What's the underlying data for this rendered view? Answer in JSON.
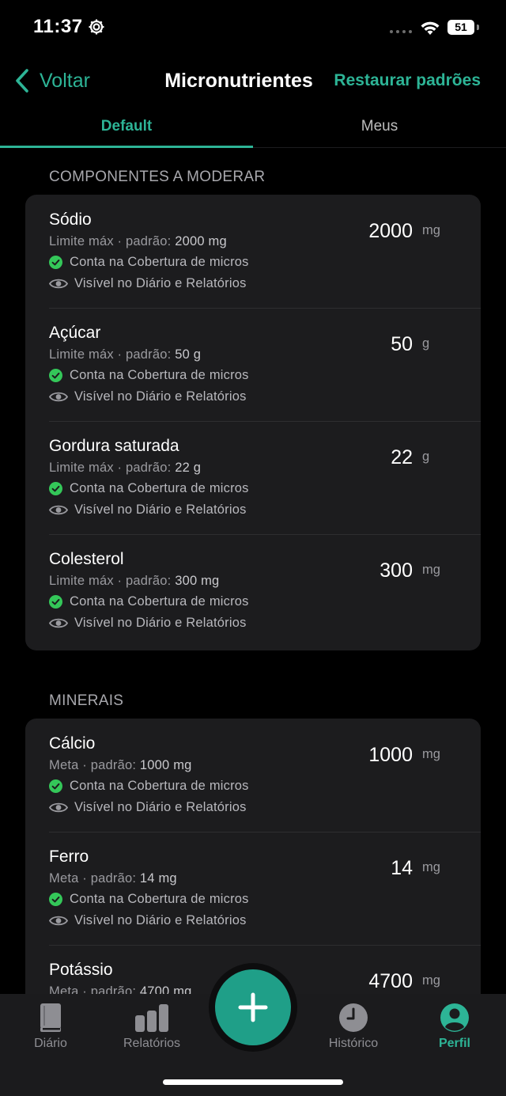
{
  "status": {
    "time": "11:37",
    "battery": "51"
  },
  "nav": {
    "back_label": "Voltar",
    "title": "Micronutrientes",
    "restore_label": "Restaurar padrões"
  },
  "tabs": [
    {
      "label": "Default"
    },
    {
      "label": "Meus"
    }
  ],
  "flags": {
    "micros": "Conta na Cobertura de micros",
    "visible": "Visível no Diário e Relatórios"
  },
  "sections": [
    {
      "title": "COMPONENTES A MODERAR",
      "items": [
        {
          "name": "Sódio",
          "limit_prefix": "Limite máx · padrão:",
          "limit_value": "2000 mg",
          "value": "2000",
          "unit": "mg"
        },
        {
          "name": "Açúcar",
          "limit_prefix": "Limite máx · padrão:",
          "limit_value": "50 g",
          "value": "50",
          "unit": "g"
        },
        {
          "name": "Gordura saturada",
          "limit_prefix": "Limite máx · padrão:",
          "limit_value": "22 g",
          "value": "22",
          "unit": "g"
        },
        {
          "name": "Colesterol",
          "limit_prefix": "Limite máx · padrão:",
          "limit_value": "300 mg",
          "value": "300",
          "unit": "mg"
        }
      ]
    },
    {
      "title": "MINERAIS",
      "items": [
        {
          "name": "Cálcio",
          "limit_prefix": "Meta · padrão:",
          "limit_value": "1000 mg",
          "value": "1000",
          "unit": "mg"
        },
        {
          "name": "Ferro",
          "limit_prefix": "Meta · padrão:",
          "limit_value": "14 mg",
          "value": "14",
          "unit": "mg"
        },
        {
          "name": "Potássio",
          "limit_prefix": "Meta · padrão:",
          "limit_value": "4700 mg",
          "value": "4700",
          "unit": "mg"
        }
      ]
    }
  ],
  "tab_bar": [
    {
      "label": "Diário",
      "icon": "book-icon"
    },
    {
      "label": "Relatórios",
      "icon": "bar-chart-icon"
    },
    {
      "label": "Histórico",
      "icon": "clock-icon"
    },
    {
      "label": "Perfil",
      "icon": "profile-icon"
    }
  ],
  "colors": {
    "accent": "#2db496",
    "fab": "#1f9f88",
    "card": "#1c1c1e",
    "check": "#34c759"
  }
}
